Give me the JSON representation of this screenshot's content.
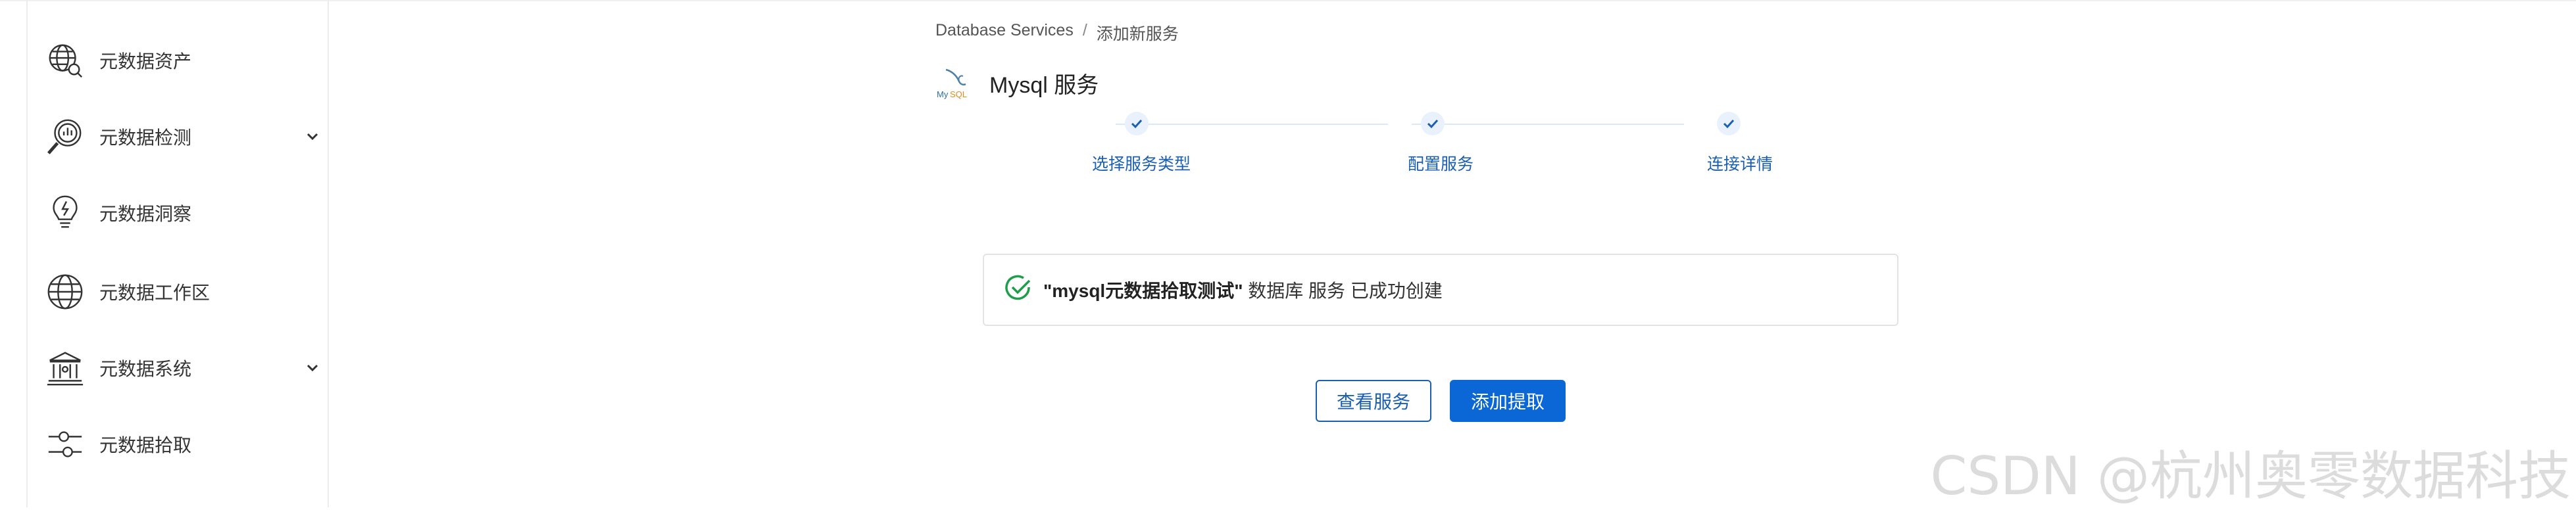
{
  "sidebar": {
    "items": [
      {
        "label": "元数据资产",
        "icon": "globe-search-icon",
        "expandable": false
      },
      {
        "label": "元数据检测",
        "icon": "magnifier-chart-icon",
        "expandable": true
      },
      {
        "label": "元数据洞察",
        "icon": "lightbulb-icon",
        "expandable": false
      },
      {
        "label": "元数据工作区",
        "icon": "globe-icon",
        "expandable": false
      },
      {
        "label": "元数据系统",
        "icon": "bank-building-icon",
        "expandable": true
      },
      {
        "label": "元数据拾取",
        "icon": "sliders-icon",
        "expandable": false
      }
    ]
  },
  "breadcrumb": {
    "root": "Database Services",
    "separator": "/",
    "current": "添加新服务"
  },
  "service": {
    "title": "Mysql 服务",
    "logo": "mysql-logo-icon"
  },
  "stepper": {
    "steps": [
      {
        "label": "选择服务类型",
        "done": true
      },
      {
        "label": "配置服务",
        "done": true
      },
      {
        "label": "连接详情",
        "done": true
      }
    ]
  },
  "success": {
    "name": "\"mysql元数据拾取测试\"",
    "text": " 数据库 服务 已成功创建"
  },
  "actions": {
    "view_label": "查看服务",
    "add_label": "添加提取"
  },
  "watermark": "CSDN @杭州奥零数据科技",
  "colors": {
    "accent": "#0b66d6",
    "success": "#1e9e4a",
    "step_text": "#1a5fb4"
  }
}
